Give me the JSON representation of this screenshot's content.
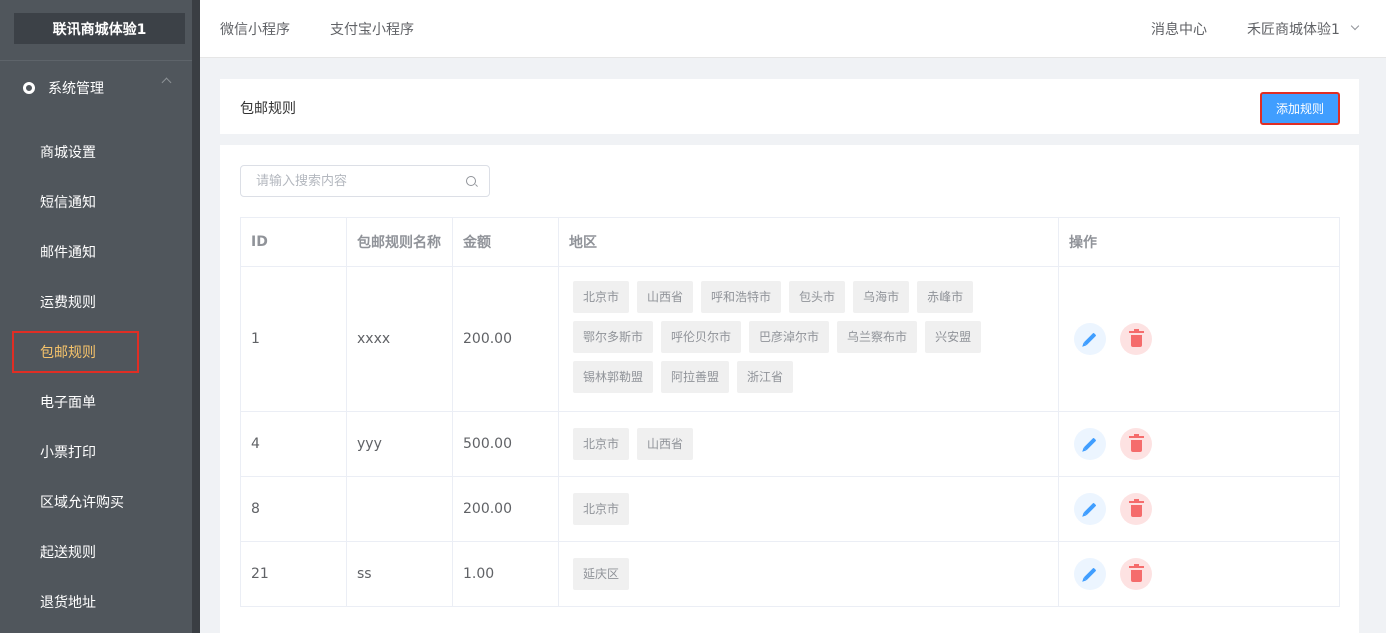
{
  "sidebar": {
    "logo": "联讯商城体验1",
    "section_title": "系统管理",
    "items": [
      {
        "label": "商城设置",
        "active": false
      },
      {
        "label": "短信通知",
        "active": false
      },
      {
        "label": "邮件通知",
        "active": false
      },
      {
        "label": "运费规则",
        "active": false
      },
      {
        "label": "包邮规则",
        "active": true
      },
      {
        "label": "电子面单",
        "active": false
      },
      {
        "label": "小票打印",
        "active": false
      },
      {
        "label": "区域允许购买",
        "active": false
      },
      {
        "label": "起送规则",
        "active": false
      },
      {
        "label": "退货地址",
        "active": false
      }
    ]
  },
  "topbar": {
    "tabs": [
      "微信小程序",
      "支付宝小程序"
    ],
    "message_center": "消息中心",
    "user": "禾匠商城体验1"
  },
  "page": {
    "title": "包邮规则",
    "add_button": "添加规则"
  },
  "search": {
    "placeholder": "请输入搜索内容",
    "value": ""
  },
  "table": {
    "headers": [
      "ID",
      "包邮规则名称",
      "金额",
      "地区",
      "操作"
    ],
    "rows": [
      {
        "id": "1",
        "name": "xxxx",
        "amount": "200.00",
        "regions": [
          "北京市",
          "山西省",
          "呼和浩特市",
          "包头市",
          "乌海市",
          "赤峰市",
          "鄂尔多斯市",
          "呼伦贝尔市",
          "巴彦淖尔市",
          "乌兰察布市",
          "兴安盟",
          "锡林郭勒盟",
          "阿拉善盟",
          "浙江省"
        ]
      },
      {
        "id": "4",
        "name": "yyy",
        "amount": "500.00",
        "regions": [
          "北京市",
          "山西省"
        ]
      },
      {
        "id": "8",
        "name": "",
        "amount": "200.00",
        "regions": [
          "北京市"
        ]
      },
      {
        "id": "21",
        "name": "ss",
        "amount": "1.00",
        "regions": [
          "延庆区"
        ]
      }
    ]
  },
  "colors": {
    "sidebar_bg": "#50565c",
    "active_menu": "#f7c46b",
    "primary": "#409eff",
    "danger": "#f56c6c",
    "highlight_border": "#e02e24"
  },
  "icons": {
    "edit": "pencil-icon",
    "delete": "trash-icon",
    "search": "search-icon",
    "section": "gear-icon"
  }
}
